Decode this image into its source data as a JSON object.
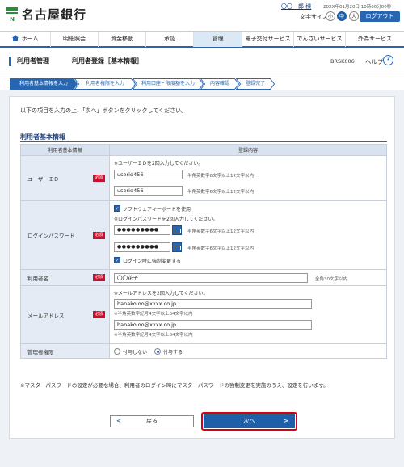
{
  "header": {
    "bank_name": "名古屋銀行",
    "user_name": "〇〇一郎 様",
    "last_login": "20XX年01月20日 10時00分00秒",
    "font_size_label": "文字サイズ",
    "font_size_small": "小",
    "font_size_medium": "中",
    "font_size_large": "大",
    "logout": "ログアウト"
  },
  "nav": {
    "items": [
      {
        "label": "ホーム",
        "icon": "home-icon"
      },
      {
        "label": "明細照会"
      },
      {
        "label": "資金移動"
      },
      {
        "label": "承認"
      },
      {
        "label": "管理",
        "active": true
      },
      {
        "label": "電子交付サービス"
      },
      {
        "label": "でんさいサービス"
      },
      {
        "label": "外為サービス"
      }
    ]
  },
  "title": {
    "section": "利用者管理",
    "page": "利用者登録［基本情報］",
    "code": "BRSK006",
    "help": "ヘルプ"
  },
  "steps": [
    {
      "label": "利用者基本情報を入力",
      "active": true
    },
    {
      "label": "利用者権限を入力"
    },
    {
      "label": "利用口座・限度額を入力"
    },
    {
      "label": "内容確認"
    },
    {
      "label": "登録完了"
    }
  ],
  "intro": "以下の項目を入力の上、「次へ」ボタンをクリックしてください。",
  "form": {
    "title": "利用者基本情報",
    "col_item": "利用者基本情報",
    "col_content": "登録内容",
    "required": "必須",
    "user_id": {
      "label": "ユーザーＩＤ",
      "note": "※ユーザーＩＤを2回入力してください。",
      "value1": "userid456",
      "value2": "userid456",
      "hint": "半角英数字6文字以上12文字以内"
    },
    "password": {
      "label": "ログインパスワード",
      "software_keyboard": "ソフトウェアキーボードを使用",
      "note": "※ログインパスワードを2回入力してください。",
      "value1": "●●●●●●●●●",
      "value2": "●●●●●●●●●",
      "hint": "半角英数字6文字以上12文字以内",
      "force_change": "ログイン時に強制変更する"
    },
    "user_name": {
      "label": "利用者名",
      "value": "〇〇花子",
      "hint": "全角30文字以内"
    },
    "email": {
      "label": "メールアドレス",
      "note": "※メールアドレスを2回入力してください。",
      "value1": "hanako.oo@xxxx.co.jp",
      "value2": "hanako.oo@xxxx.co.jp",
      "hint": "※半角英数字記号4文字以上64文字以内"
    },
    "admin": {
      "label": "管理者権限",
      "option_off": "付与しない",
      "option_on": "付与する"
    }
  },
  "footnote": "※マスターパスワードの設定が必要な場合、利用者のログイン時にマスターパスワードの強制変更を実施のうえ、設定を行います。",
  "buttons": {
    "back": "戻る",
    "next": "次へ"
  }
}
